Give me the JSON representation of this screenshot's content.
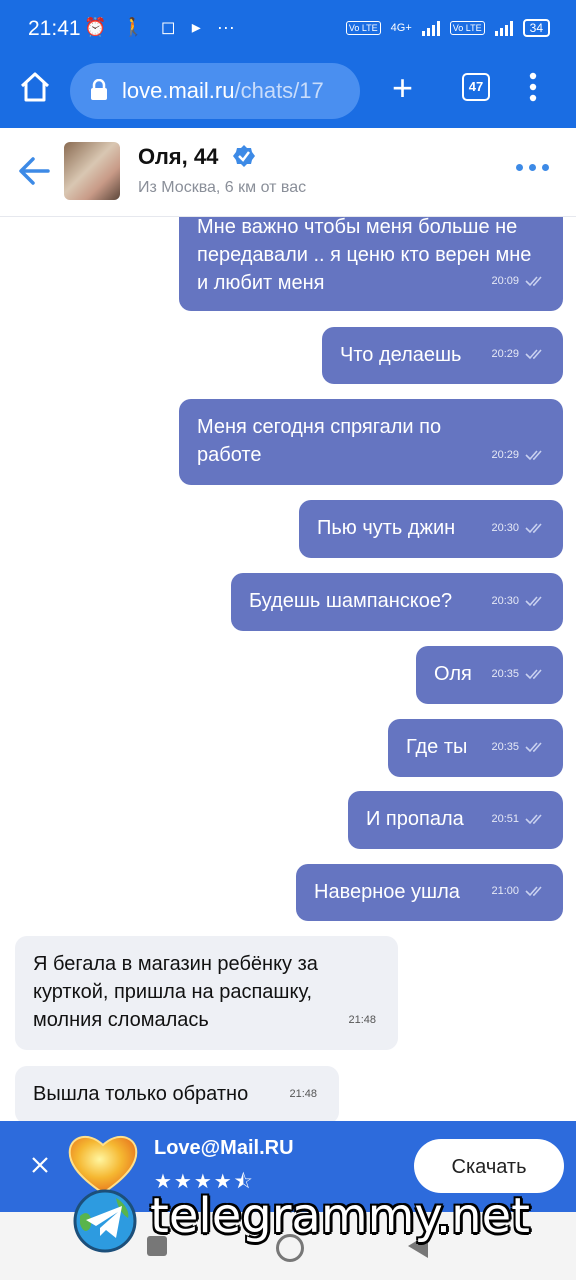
{
  "status_bar": {
    "time": "21:41",
    "net_labels": [
      "Vo LTE",
      "4G+",
      "Vo LTE"
    ],
    "battery": "34"
  },
  "browser": {
    "url_host": "love.mail.ru",
    "url_path": "/chats/17",
    "tab_count": "47"
  },
  "chat_header": {
    "name": "Оля, 44",
    "subtitle": "Из Москва, 6 км от вас"
  },
  "messages": [
    {
      "direction": "out",
      "text": "Мне важно чтобы меня больше не передавали .. я ценю кто верен мне и любит меня",
      "time": "20:09"
    },
    {
      "direction": "out",
      "text": "Что делаешь",
      "time": "20:29"
    },
    {
      "direction": "out",
      "text": "Меня сегодня спрягали по работе",
      "time": "20:29"
    },
    {
      "direction": "out",
      "text": "Пью чуть джин",
      "time": "20:30"
    },
    {
      "direction": "out",
      "text": "Будешь шампанское?",
      "time": "20:30"
    },
    {
      "direction": "out",
      "text": "Оля",
      "time": "20:35"
    },
    {
      "direction": "out",
      "text": "Где ты",
      "time": "20:35"
    },
    {
      "direction": "out",
      "text": "И пропала",
      "time": "20:51"
    },
    {
      "direction": "out",
      "text": "Наверное ушла",
      "time": "21:00"
    },
    {
      "direction": "in",
      "text": "Я бегала в магазин ребёнку за курткой, пришла на распашку, молния сломалась",
      "time": "21:48"
    },
    {
      "direction": "in",
      "text": "Вышла только обратно",
      "time": "21:48"
    }
  ],
  "app_banner": {
    "app_name": "Love@Mail.RU",
    "rating": 4.5,
    "stars_text": "★★★★⯪",
    "download_label": "Скачать"
  },
  "watermark": {
    "text": "telegrammy.net"
  },
  "colors": {
    "brand_blue": "#1a6de3",
    "outgoing_bubble": "#6575c1",
    "incoming_bubble": "#eef0f5",
    "banner_blue": "#2d6bdc"
  }
}
